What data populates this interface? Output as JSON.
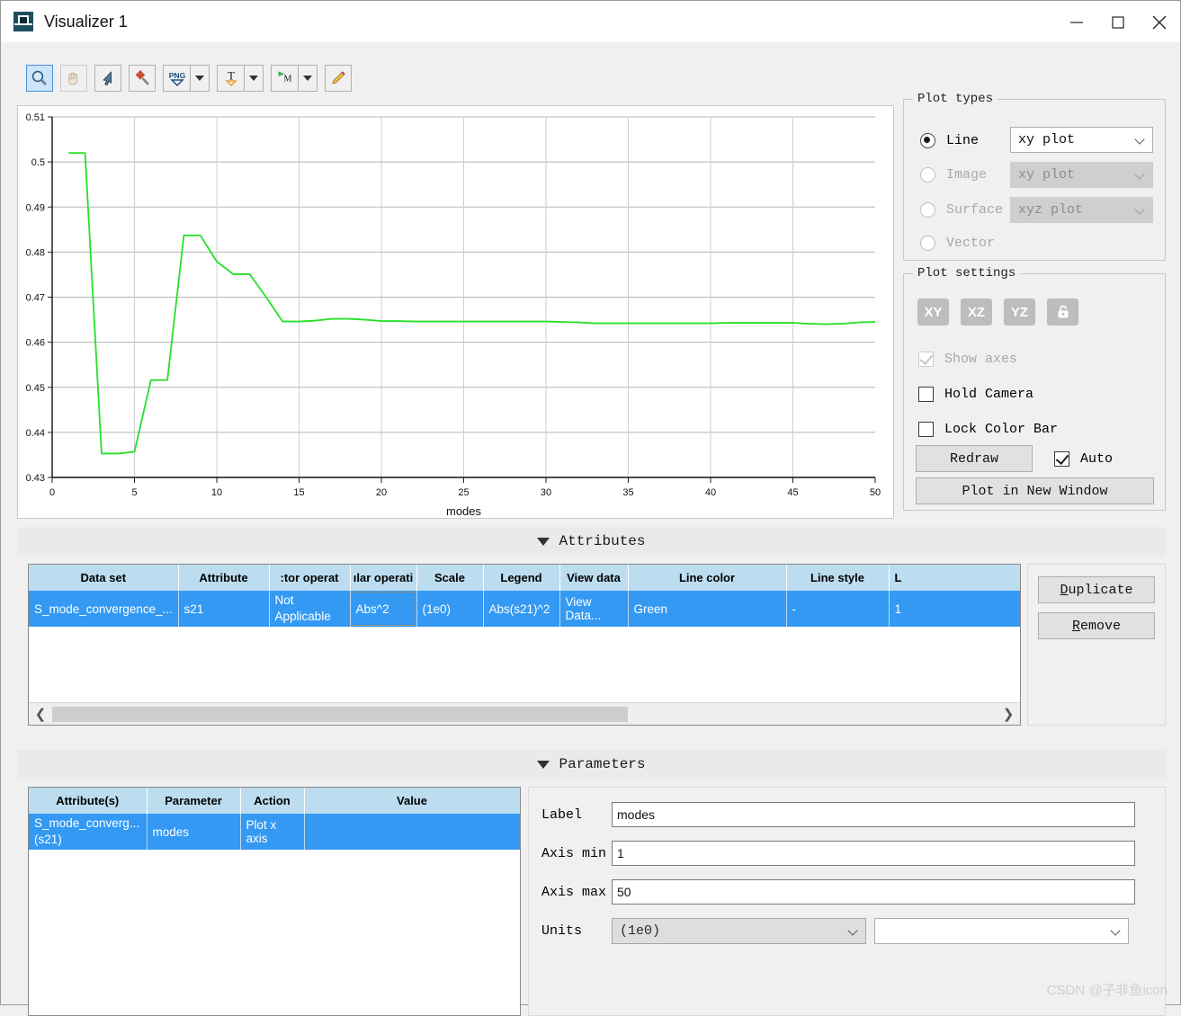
{
  "window": {
    "title": "Visualizer 1",
    "app_icon": "visualizer-app-icon",
    "minimize": "–",
    "maximize": "□",
    "close": "✕"
  },
  "toolbar": {
    "items": [
      {
        "name": "zoom-tool",
        "icon": "magnifier-icon",
        "selected": true,
        "disabled": false,
        "dropdown": false
      },
      {
        "name": "pan-tool",
        "icon": "hand-icon",
        "selected": false,
        "disabled": true,
        "dropdown": false
      },
      {
        "name": "select-tool",
        "icon": "cursor-arrow-icon",
        "selected": false,
        "disabled": false,
        "dropdown": false
      },
      {
        "name": "move-tool",
        "icon": "move-wand-icon",
        "selected": false,
        "disabled": false,
        "dropdown": false
      },
      {
        "name": "export-image-tool",
        "icon": "png-export-icon",
        "selected": false,
        "disabled": false,
        "dropdown": true
      },
      {
        "name": "text-annotation-tool",
        "icon": "text-t-icon",
        "selected": false,
        "disabled": false,
        "dropdown": true
      },
      {
        "name": "marker-tool",
        "icon": "marker-m-icon",
        "selected": false,
        "disabled": false,
        "dropdown": true
      },
      {
        "name": "draw-tool",
        "icon": "pencil-icon",
        "selected": false,
        "disabled": false,
        "dropdown": false
      }
    ]
  },
  "plot_types": {
    "legend": "Plot types",
    "options": [
      {
        "label": "Line",
        "selected": true,
        "disabled": false,
        "combo": "xy plot",
        "combo_disabled": false,
        "has_combo": true
      },
      {
        "label": "Image",
        "selected": false,
        "disabled": true,
        "combo": "xy plot",
        "combo_disabled": true,
        "has_combo": true
      },
      {
        "label": "Surface",
        "selected": false,
        "disabled": true,
        "combo": "xyz plot",
        "combo_disabled": true,
        "has_combo": true
      },
      {
        "label": "Vector",
        "selected": false,
        "disabled": true,
        "combo": "",
        "combo_disabled": true,
        "has_combo": false
      }
    ]
  },
  "plot_settings": {
    "legend": "Plot settings",
    "axis_buttons": [
      {
        "label": "XY",
        "name": "xy-view-button"
      },
      {
        "label": "XZ",
        "name": "xz-view-button"
      },
      {
        "label": "YZ",
        "name": "yz-view-button"
      }
    ],
    "lock_button_icon": "padlock-icon",
    "checkboxes": [
      {
        "label": "Show axes",
        "checked": true,
        "disabled": true
      },
      {
        "label": "Hold Camera",
        "checked": false,
        "disabled": false
      },
      {
        "label": "Lock Color Bar",
        "checked": false,
        "disabled": false
      }
    ],
    "redraw_label": "Redraw",
    "auto_label": "Auto",
    "auto_checked": true,
    "plot_new_window_label": "Plot in New Window"
  },
  "sections": {
    "attributes_header": "Attributes",
    "parameters_header": "Parameters"
  },
  "attributes_table": {
    "columns": [
      "Data set",
      "Attribute",
      ":tor operat",
      "ılar operati",
      "Scale",
      "Legend",
      "View data",
      "Line color",
      "Line style",
      "L"
    ],
    "rows": [
      {
        "data_set": "S_mode_convergence_...",
        "attribute": "s21",
        "vector_operation": "Not Applicable",
        "scalar_operation": "Abs^2",
        "scale": "(1e0)",
        "legend": "Abs(s21)^2",
        "view_data": "View Data...",
        "line_color": "Green",
        "line_style": "-",
        "line_width": "1"
      }
    ],
    "buttons": {
      "duplicate": "Duplicate",
      "remove": "Remove"
    }
  },
  "parameters_table": {
    "columns": [
      "Attribute(s)",
      "Parameter",
      "Action",
      "Value"
    ],
    "rows": [
      {
        "attributes": "S_mode_converg... (s21)",
        "parameter": "modes",
        "action": "Plot x axis",
        "value": ""
      }
    ]
  },
  "parameters_form": {
    "label_label": "Label",
    "label_value": "modes",
    "axis_min_label": "Axis min",
    "axis_min_value": "1",
    "axis_max_label": "Axis max",
    "axis_max_value": "50",
    "units_label": "Units",
    "units_value": "(1e0)",
    "units_value2": ""
  },
  "watermark": "CSDN @子非鱼icon",
  "colors": {
    "line": "#27e027",
    "selection": "#3399f3",
    "header": "#bcdcf0",
    "accent": "#4a90d9"
  },
  "chart_data": {
    "type": "line",
    "title": "",
    "xlabel": "modes",
    "ylabel": "",
    "xlim": [
      0,
      50
    ],
    "ylim": [
      0.43,
      0.51
    ],
    "xticks": [
      0,
      5,
      10,
      15,
      20,
      25,
      30,
      35,
      40,
      45,
      50
    ],
    "yticks": [
      0.43,
      0.44,
      0.45,
      0.46,
      0.47,
      0.48,
      0.49,
      0.5,
      0.51
    ],
    "grid": true,
    "legend": "Abs(s21)^2",
    "line_color": "#27e027",
    "series": [
      {
        "name": "Abs(s21)^2",
        "x": [
          1,
          2,
          3,
          4,
          5,
          6,
          7,
          8,
          9,
          10,
          11,
          12,
          13,
          14,
          15,
          16,
          17,
          18,
          19,
          20,
          21,
          22,
          23,
          24,
          25,
          26,
          27,
          28,
          29,
          30,
          31,
          32,
          33,
          34,
          35,
          36,
          37,
          38,
          39,
          40,
          41,
          42,
          43,
          44,
          45,
          46,
          47,
          48,
          49,
          50
        ],
        "y": [
          0.502,
          0.502,
          0.4353,
          0.4353,
          0.4357,
          0.4516,
          0.4516,
          0.4837,
          0.4837,
          0.4779,
          0.4751,
          0.4751,
          0.47,
          0.4646,
          0.4646,
          0.4648,
          0.4652,
          0.4652,
          0.465,
          0.4647,
          0.4647,
          0.4646,
          0.4646,
          0.4646,
          0.4646,
          0.4646,
          0.4646,
          0.4646,
          0.4646,
          0.4646,
          0.4645,
          0.4644,
          0.4642,
          0.4642,
          0.4642,
          0.4642,
          0.4642,
          0.4642,
          0.4642,
          0.4642,
          0.4643,
          0.4643,
          0.4643,
          0.4643,
          0.4643,
          0.4641,
          0.464,
          0.4641,
          0.4644,
          0.4645
        ]
      }
    ]
  }
}
